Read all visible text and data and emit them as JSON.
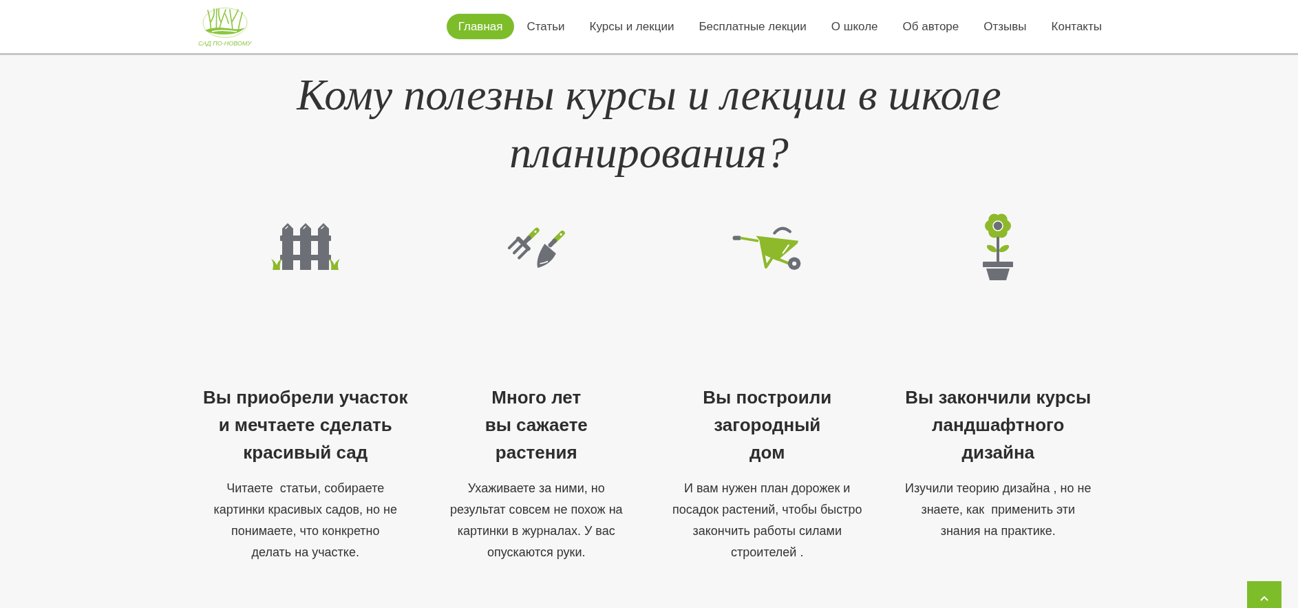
{
  "header": {
    "logo_text": "САД ПО-НОВОМУ",
    "nav": [
      {
        "label": "Главная",
        "selected": true
      },
      {
        "label": "Статьи",
        "selected": false
      },
      {
        "label": "Курсы и лекции",
        "selected": false
      },
      {
        "label": "Бесплатные лекции",
        "selected": false
      },
      {
        "label": "О школе",
        "selected": false
      },
      {
        "label": "Об авторе",
        "selected": false
      },
      {
        "label": "Отзывы",
        "selected": false
      },
      {
        "label": "Контакты",
        "selected": false
      }
    ]
  },
  "title": "Кому полезны курсы и лекции в школе планирования?",
  "features": [
    {
      "kind": "fence",
      "heading": "Вы приобрели участок\nи мечтаете сделать\nкрасивый сад",
      "text": "Читаете  статьи, собираете\nкартинки красивых садов, но не\nпонимаете, что конкретно\nделать на участке."
    },
    {
      "kind": "tools",
      "heading": "Много лет\nвы сажаете\nрастения",
      "text": "Ухаживаете за ними, но\nрезультат совсем не похож на\nкартинки в журналах. У вас\nопускаются руки."
    },
    {
      "kind": "wheelbarrow",
      "heading": "Вы построили\nзагородный\nдом",
      "text": "И вам нужен план дорожек и\nпосадок растений, чтобы быстро\nзакончить работы силами\nстроителей ."
    },
    {
      "kind": "flower",
      "heading": "Вы закончили курсы\nландшафтного\nдизайна",
      "text": "Изучили теорию дизайна , но не\nзнаете, как  применить эти\nзнания на практике."
    }
  ]
}
